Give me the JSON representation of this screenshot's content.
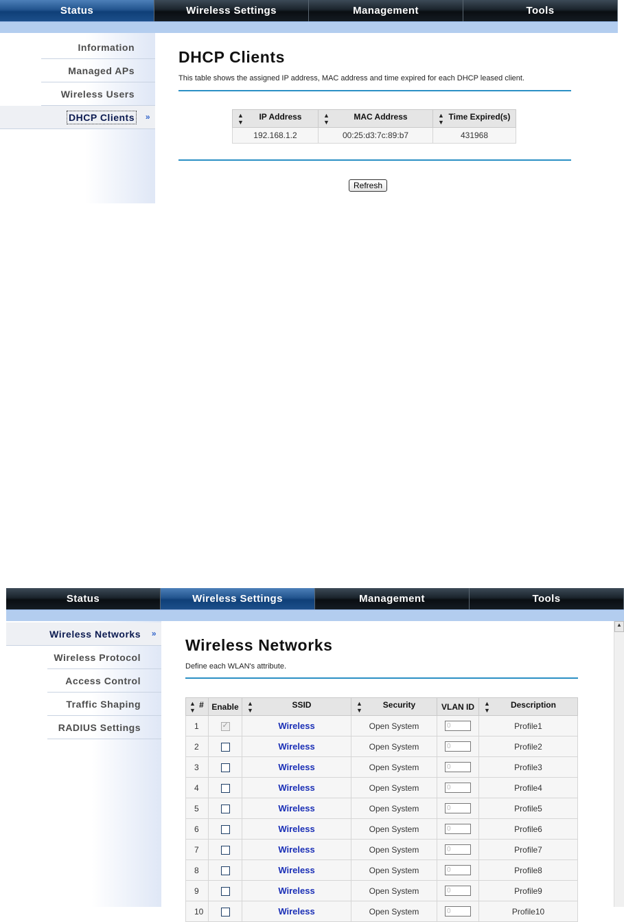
{
  "screen1": {
    "nav": [
      "Status",
      "Wireless Settings",
      "Management",
      "Tools"
    ],
    "sidebar": [
      "Information",
      "Managed APs",
      "Wireless Users",
      "DHCP Clients"
    ],
    "title": "DHCP Clients",
    "description": "This table shows the assigned IP address, MAC address and time expired for each DHCP leased client.",
    "table": {
      "headers": [
        "IP Address",
        "MAC Address",
        "Time Expired(s)"
      ],
      "rows": [
        [
          "192.168.1.2",
          "00:25:d3:7c:89:b7",
          "431968"
        ]
      ]
    },
    "refresh_label": "Refresh"
  },
  "screen2": {
    "nav": [
      "Status",
      "Wireless Settings",
      "Management",
      "Tools"
    ],
    "sidebar": [
      "Wireless Networks",
      "Wireless Protocol",
      "Access Control",
      "Traffic Shaping",
      "RADIUS Settings"
    ],
    "title": "Wireless Networks",
    "description": "Define each WLAN's attribute.",
    "table": {
      "headers": [
        "#",
        "Enable",
        "SSID",
        "Security",
        "VLAN ID",
        "Description"
      ],
      "rows": [
        {
          "num": "1",
          "ssid": "Wireless",
          "security": "Open System",
          "vlan": "0",
          "description": "Profile1",
          "enabled": true
        },
        {
          "num": "2",
          "ssid": "Wireless",
          "security": "Open System",
          "vlan": "0",
          "description": "Profile2",
          "enabled": false
        },
        {
          "num": "3",
          "ssid": "Wireless",
          "security": "Open System",
          "vlan": "0",
          "description": "Profile3",
          "enabled": false
        },
        {
          "num": "4",
          "ssid": "Wireless",
          "security": "Open System",
          "vlan": "0",
          "description": "Profile4",
          "enabled": false
        },
        {
          "num": "5",
          "ssid": "Wireless",
          "security": "Open System",
          "vlan": "0",
          "description": "Profile5",
          "enabled": false
        },
        {
          "num": "6",
          "ssid": "Wireless",
          "security": "Open System",
          "vlan": "0",
          "description": "Profile6",
          "enabled": false
        },
        {
          "num": "7",
          "ssid": "Wireless",
          "security": "Open System",
          "vlan": "0",
          "description": "Profile7",
          "enabled": false
        },
        {
          "num": "8",
          "ssid": "Wireless",
          "security": "Open System",
          "vlan": "0",
          "description": "Profile8",
          "enabled": false
        },
        {
          "num": "9",
          "ssid": "Wireless",
          "security": "Open System",
          "vlan": "0",
          "description": "Profile9",
          "enabled": false
        },
        {
          "num": "10",
          "ssid": "Wireless",
          "security": "Open System",
          "vlan": "0",
          "description": "Profile10",
          "enabled": false
        }
      ]
    }
  }
}
